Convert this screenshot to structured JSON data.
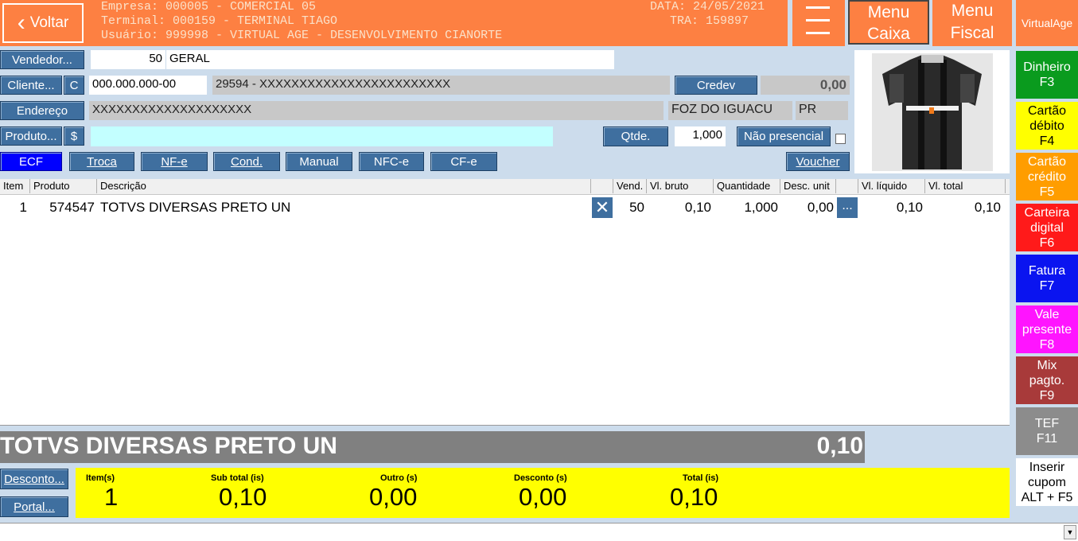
{
  "header": {
    "back_label": "Voltar",
    "empresa": "Empresa: 000005 - COMERCIAL 05",
    "terminal": "Terminal: 000159 - TERMINAL TIAGO",
    "usuario": "Usuário: 999998 - VIRTUAL AGE - DESENVOLVIMENTO CIANORTE",
    "data": "DATA: 24/05/2021",
    "tra": "TRA: 159897",
    "menu_caixa_1": "Menu",
    "menu_caixa_2": "Caixa",
    "menu_fiscal_1": "Menu",
    "menu_fiscal_2": "Fiscal",
    "virtualage": "VirtualAge"
  },
  "form": {
    "vendedor_label": "Vendedor...",
    "vendedor_code": "50",
    "vendedor_name": "GERAL",
    "cliente_label": "Cliente...",
    "cliente_c": "C",
    "cliente_doc": "000.000.000-00",
    "cliente_name": "29594 - XXXXXXXXXXXXXXXXXXXXXXXX",
    "credev_label": "Credev",
    "credev_value": "0,00",
    "endereco_label": "Endereço",
    "endereco_value": "XXXXXXXXXXXXXXXXXXXX",
    "cidade": "FOZ DO IGUACU",
    "uf": "PR",
    "produto_label": "Produto...",
    "produto_dollar": "$",
    "produto_value": "",
    "qtde_label": "Qtde.",
    "qtde_value": "1,000",
    "nao_presencial_label": "Não presencial"
  },
  "modes": [
    "ECF",
    "Troca",
    "NF-e",
    "Cond.",
    "Manual",
    "NFC-e",
    "CF-e"
  ],
  "voucher_label": "Voucher",
  "table": {
    "headers": [
      "Item",
      "Produto",
      "Descrição",
      "",
      "Vend.",
      "Vl. bruto",
      "Quantidade",
      "Desc. unit",
      "",
      "Vl. líquido",
      "Vl. total"
    ],
    "rows": [
      {
        "item": "1",
        "produto": "574547",
        "descricao": "TOTVS DIVERSAS PRETO UN",
        "vend": "50",
        "vl_bruto": "0,10",
        "quantidade": "1,000",
        "desc_unit": "0,00",
        "more": "...",
        "vl_liquido": "0,10",
        "vl_total": "0,10"
      }
    ]
  },
  "current": {
    "desc": "TOTVS DIVERSAS PRETO UN",
    "value": "0,10"
  },
  "bottom": {
    "desconto_label": "Desconto...",
    "portal_label": "Portal..."
  },
  "totals": [
    {
      "label": "Item(s)",
      "value": "1"
    },
    {
      "label": "Sub total (is)",
      "value": "0,10"
    },
    {
      "label": "Outro (s)",
      "value": "0,00"
    },
    {
      "label": "Desconto (s)",
      "value": "0,00"
    },
    {
      "label": "Total (is)",
      "value": "0,10"
    }
  ],
  "sidebar": [
    {
      "l1": "Dinheiro",
      "l2": "F3",
      "l3": "",
      "color": "#0a9b1e",
      "text": "#ffffff"
    },
    {
      "l1": "Cartão",
      "l2": "débito",
      "l3": "F4",
      "color": "#ffff00",
      "text": "#000000"
    },
    {
      "l1": "Cartão",
      "l2": "crédito",
      "l3": "F5",
      "color": "#ff9d00",
      "text": "#ffffff"
    },
    {
      "l1": "Carteira",
      "l2": "digital",
      "l3": "F6",
      "color": "#ff1a1a",
      "text": "#ffffff"
    },
    {
      "l1": "Fatura",
      "l2": "F7",
      "l3": "",
      "color": "#0a14f0",
      "text": "#ffffff"
    },
    {
      "l1": "Vale",
      "l2": "presente",
      "l3": "F8",
      "color": "#ff14ff",
      "text": "#ffffff"
    },
    {
      "l1": "Mix",
      "l2": "pagto.",
      "l3": "F9",
      "color": "#a83a3a",
      "text": "#ffffff"
    },
    {
      "l1": "TEF",
      "l2": "F11",
      "l3": "",
      "color": "#8c8c8c",
      "text": "#ffffff"
    },
    {
      "l1": "Inserir",
      "l2": "cupom",
      "l3": "ALT + F5",
      "color": "#ffffff",
      "text": "#000000"
    }
  ]
}
